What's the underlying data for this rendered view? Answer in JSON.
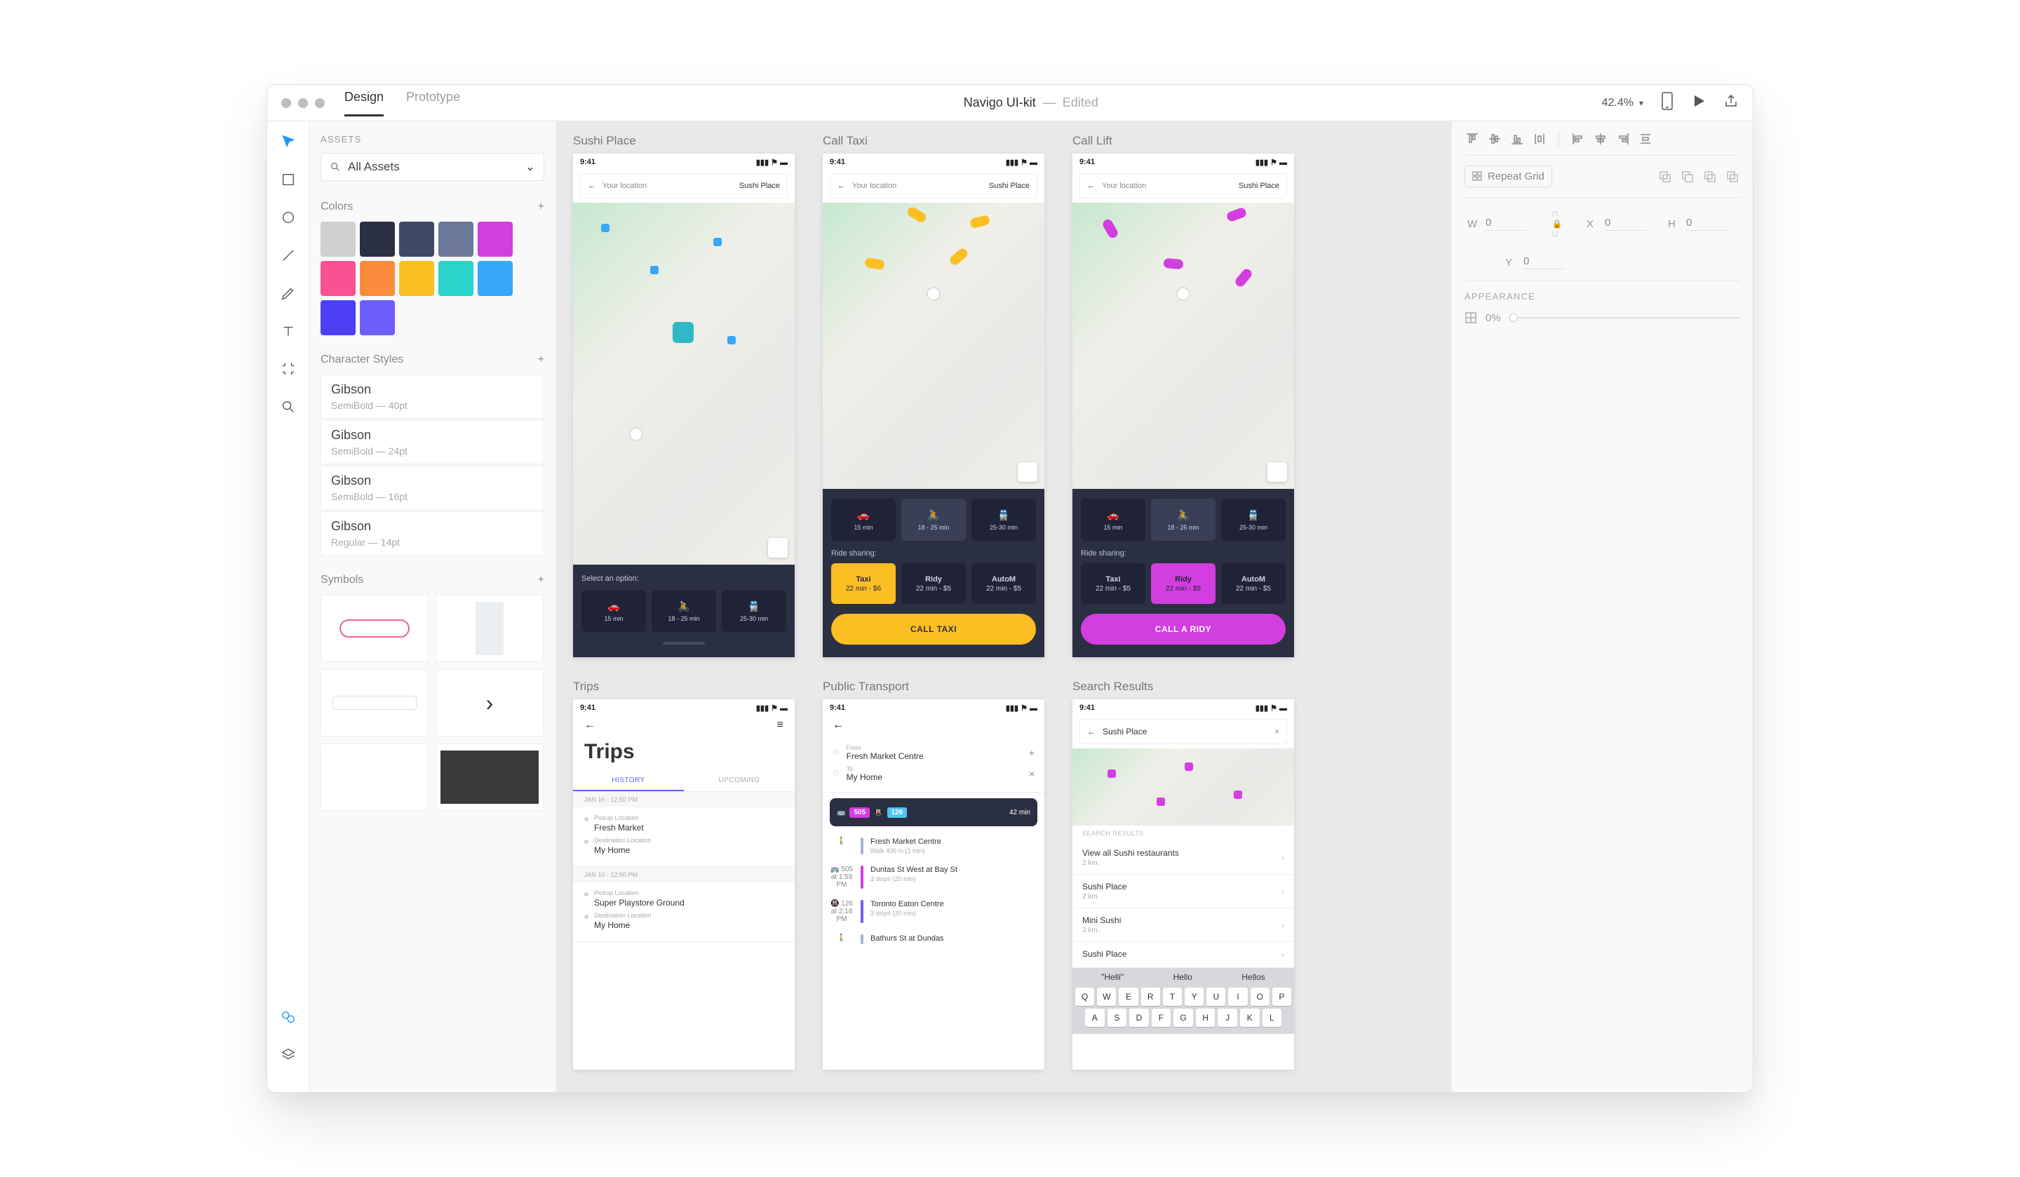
{
  "window": {
    "tabs": [
      "Design",
      "Prototype"
    ],
    "active_tab": 0,
    "title": "Navigo UI-kit",
    "status": "Edited",
    "zoom": "42.4%"
  },
  "assets": {
    "header": "ASSETS",
    "dropdown": "All Assets",
    "colors_label": "Colors",
    "colors": [
      "#cfcfcf",
      "#2b2f42",
      "#3c4a63",
      "#6b7897",
      "#d23ee0",
      "#f95292",
      "#fb8c3c",
      "#fbbf24",
      "#2ad4c9",
      "#36a7f9",
      "#4a3ff6",
      "#6d5efb"
    ],
    "charstyles_label": "Character Styles",
    "charstyles": [
      {
        "name": "Gibson",
        "meta": "SemiBold — 40pt"
      },
      {
        "name": "Gibson",
        "meta": "SemiBold — 24pt"
      },
      {
        "name": "Gibson",
        "meta": "SemiBold — 16pt"
      },
      {
        "name": "Gibson",
        "meta": "Regular — 14pt"
      }
    ],
    "symbols_label": "Symbols"
  },
  "artboard_common": {
    "time": "9:41",
    "your_location": "Your location",
    "sushi_place": "Sushi Place",
    "select_option": "Select an option:",
    "ride_sharing": "Ride sharing:",
    "timecells": [
      {
        "label": "15 min"
      },
      {
        "label": "18 - 25 min"
      },
      {
        "label": "25-30 min"
      }
    ]
  },
  "artboards": {
    "a1": {
      "title": "Sushi Place"
    },
    "a2": {
      "title": "Call Taxi",
      "cells": [
        {
          "name": "Taxi",
          "sub": "22 min - $6"
        },
        {
          "name": "Ridy",
          "sub": "22 min - $5"
        },
        {
          "name": "AutoM",
          "sub": "22 min - $5"
        }
      ],
      "call": "CALL TAXI",
      "accent": "#fbbf24"
    },
    "a3": {
      "title": "Call Lift",
      "cells": [
        {
          "name": "Taxi",
          "sub": "22 min - $5"
        },
        {
          "name": "Ridy",
          "sub": "22 min - $5"
        },
        {
          "name": "AutoM",
          "sub": "22 min - $5"
        }
      ],
      "call": "CALL A RIDY",
      "accent": "#d23ee0"
    },
    "trips": {
      "title": "Trips",
      "heading": "Trips",
      "tabs": [
        "HISTORY",
        "UPCOMING"
      ],
      "date1": "JAN 16 - 12:50 PM",
      "pickup_lbl": "Pickup Location",
      "dest_lbl": "Destination Location",
      "t1_pickup": "Fresh Market",
      "t1_dest": "My Home",
      "date2": "JAN 10 - 12:50 PM",
      "t2_pickup": "Super Playstore Ground",
      "t2_dest": "My Home"
    },
    "pt": {
      "title": "Public Transport",
      "from_lbl": "From",
      "from_val": "Fresh Market Centre",
      "to_lbl": "To",
      "to_val": "My Home",
      "chip1": "505",
      "chip2": "126",
      "duration": "42 min",
      "steps": [
        {
          "ico": "🚶",
          "line": "#a8b2d1",
          "t1": "Fresh Market Centre",
          "t2": "Walk 400 m (1 min)"
        },
        {
          "ico": "🚌 505\nat 1:59 PM",
          "line": "#d23ee0",
          "t1": "Duntas St West at Bay St",
          "t2": "3 stops (20 min)"
        },
        {
          "ico": "🚇 126\nat 2:18 PM",
          "line": "#6d5efb",
          "t1": "Toronto Eaton Centre",
          "t2": "3 stops (20 min)"
        },
        {
          "ico": "🚶",
          "line": "#a8b2d1",
          "t1": "Bathurs St at Dundas",
          "t2": ""
        }
      ]
    },
    "sr": {
      "title": "Search Results",
      "query": "Sushi Place",
      "results_hdr": "SEARCH RESULTS",
      "results": [
        {
          "t": "View all Sushi restaurants",
          "s": "2 km."
        },
        {
          "t": "Sushi Place",
          "s": "2 km."
        },
        {
          "t": "Mini Sushi",
          "s": "2 km."
        },
        {
          "t": "Sushi Place",
          "s": ""
        }
      ],
      "suggestions": [
        "\"Helli\"",
        "Hello",
        "Hellos"
      ],
      "row1": [
        "Q",
        "W",
        "E",
        "R",
        "T",
        "Y",
        "U",
        "I",
        "O",
        "P"
      ],
      "row2": [
        "A",
        "S",
        "D",
        "F",
        "G",
        "H",
        "J",
        "K",
        "L"
      ]
    }
  },
  "inspector": {
    "repeat": "Repeat Grid",
    "W": "0",
    "X": "0",
    "H": "0",
    "Y": "0",
    "appearance": "APPEARANCE",
    "opacity": "0%"
  }
}
